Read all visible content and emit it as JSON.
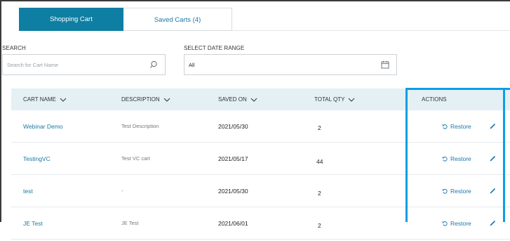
{
  "tabs": [
    {
      "label": "Shopping Cart",
      "active": true
    },
    {
      "label": "Saved Carts (4)",
      "active": false
    }
  ],
  "search": {
    "label": "SEARCH",
    "placeholder": "Search for Cart Name",
    "icon": "search-icon"
  },
  "date_range": {
    "label": "SELECT DATE RANGE",
    "value": "All",
    "icon": "calendar-icon"
  },
  "table": {
    "columns": [
      "CART NAME",
      "DESCRIPTION",
      "SAVED ON",
      "TOTAL QTY",
      "ACTIONS"
    ],
    "rows": [
      {
        "name": "Webinar Demo",
        "description": "Test Description",
        "saved_on": "2021/05/30",
        "qty": "2"
      },
      {
        "name": "TestingVC",
        "description": "Test VC cart",
        "saved_on": "2021/05/17",
        "qty": "44"
      },
      {
        "name": "test",
        "description": "-",
        "saved_on": "2021/05/30",
        "qty": "2"
      },
      {
        "name": "JE Test",
        "description": "JE Test",
        "saved_on": "2021/06/01",
        "qty": "2"
      }
    ],
    "restore_label": "Restore"
  },
  "colors": {
    "accent": "#0e7fa3",
    "link": "#1a78a8",
    "header_bg": "#e4f0f4",
    "highlight": "#0a9ee6"
  }
}
